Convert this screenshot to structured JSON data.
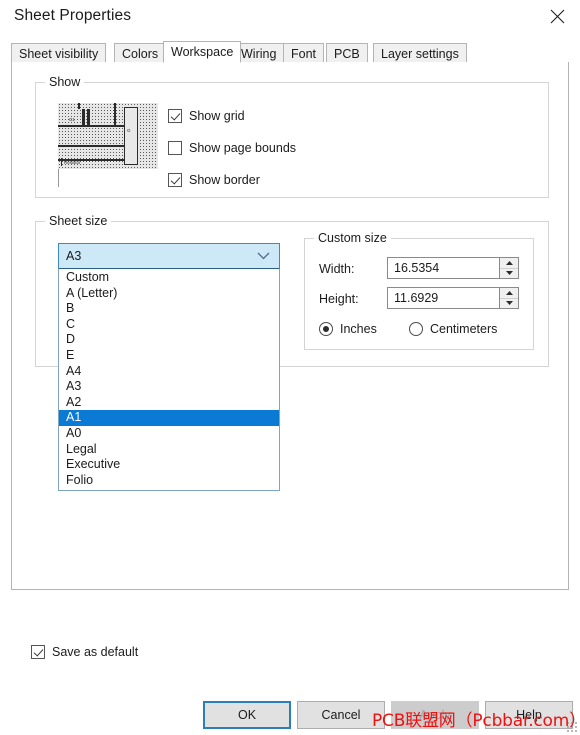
{
  "window": {
    "title": "Sheet Properties",
    "close_icon": "close-icon"
  },
  "tabs": [
    {
      "label": "Sheet visibility",
      "active": false
    },
    {
      "label": "Colors",
      "active": false
    },
    {
      "label": "Workspace",
      "active": true
    },
    {
      "label": "Wiring",
      "active": false
    },
    {
      "label": "Font",
      "active": false
    },
    {
      "label": "PCB",
      "active": false
    },
    {
      "label": "Layer settings",
      "active": false
    }
  ],
  "show_group": {
    "title": "Show",
    "preview_labels": {
      "c1": "C1",
      "g": "G",
      "footer": "Resistor"
    },
    "checkboxes": [
      {
        "label": "Show grid",
        "checked": true
      },
      {
        "label": "Show page bounds",
        "checked": false
      },
      {
        "label": "Show border",
        "checked": true
      }
    ]
  },
  "sheet_size_group": {
    "title": "Sheet size",
    "combo_value": "A3",
    "combo_arrow_icon": "chevron-down-icon",
    "options": [
      {
        "label": "Custom",
        "selected": false
      },
      {
        "label": "A (Letter)",
        "selected": false
      },
      {
        "label": "B",
        "selected": false
      },
      {
        "label": "C",
        "selected": false
      },
      {
        "label": "D",
        "selected": false
      },
      {
        "label": "E",
        "selected": false
      },
      {
        "label": "A4",
        "selected": false
      },
      {
        "label": "A3",
        "selected": false
      },
      {
        "label": "A2",
        "selected": false
      },
      {
        "label": "A1",
        "selected": true
      },
      {
        "label": "A0",
        "selected": false
      },
      {
        "label": "Legal",
        "selected": false
      },
      {
        "label": "Executive",
        "selected": false
      },
      {
        "label": "Folio",
        "selected": false
      }
    ]
  },
  "custom_size_group": {
    "title": "Custom size",
    "width_label": "Width:",
    "width_value": "16.5354",
    "height_label": "Height:",
    "height_value": "11.6929",
    "spin_up_icon": "spin-up-icon",
    "spin_down_icon": "spin-down-icon",
    "units": [
      {
        "label": "Inches",
        "selected": true
      },
      {
        "label": "Centimeters",
        "selected": false
      }
    ]
  },
  "save_as_default": {
    "label": "Save as default",
    "checked": true
  },
  "buttons": {
    "ok": "OK",
    "cancel": "Cancel",
    "apply": "Apply",
    "help": "Help"
  },
  "watermark": {
    "text": "PCB联盟网（Pcbbar.com）",
    "color": "#ee1111"
  },
  "colors": {
    "accent": "#0b7ad4",
    "combo_highlight": "#cde8f7",
    "panel_border": "#b4b4b4",
    "group_border": "#d4d4d4"
  }
}
